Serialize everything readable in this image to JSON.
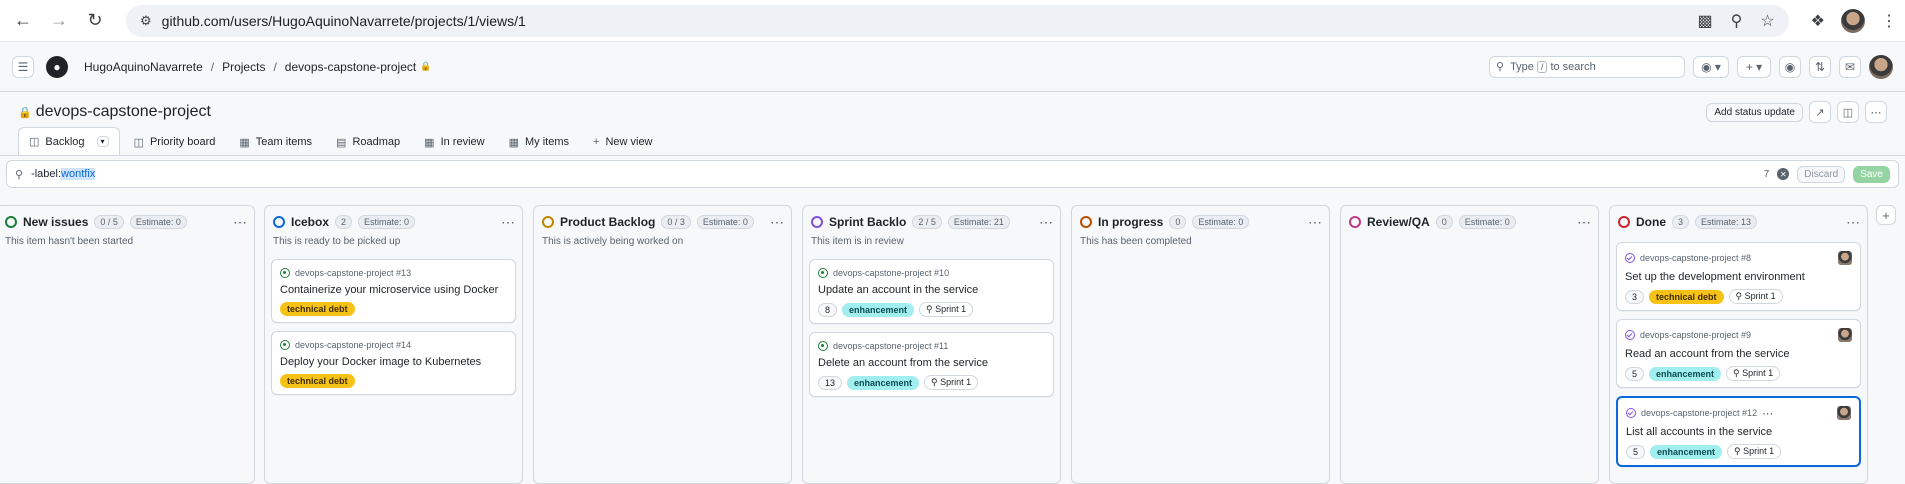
{
  "browser": {
    "url": "github.com/users/HugoAquinoNavarrete/projects/1/views/1"
  },
  "header": {
    "user": "HugoAquinoNavarrete",
    "projects": "Projects",
    "project": "devops-capstone-project",
    "search_prefix": "Type",
    "search_key": "/",
    "search_suffix": "to search"
  },
  "project": {
    "title": "devops-capstone-project",
    "status_update": "Add status update"
  },
  "tabs": [
    {
      "label": "Backlog"
    },
    {
      "label": "Priority board"
    },
    {
      "label": "Team items"
    },
    {
      "label": "Roadmap"
    },
    {
      "label": "In review"
    },
    {
      "label": "My items"
    },
    {
      "label": "New view"
    }
  ],
  "filter": {
    "prefix": "-label:",
    "value": "wontfix",
    "count": "7",
    "discard": "Discard",
    "save": "Save"
  },
  "columns": [
    {
      "name": "New issues",
      "count": "0 / 5",
      "estimate": "Estimate: 0",
      "desc": "This item hasn't been started",
      "color": "#1a7f37",
      "cards": []
    },
    {
      "name": "Icebox",
      "count": "2",
      "estimate": "Estimate: 0",
      "desc": "This is ready to be picked up",
      "color": "#0969da",
      "cards": [
        {
          "ref": "devops-capstone-project #13",
          "title": "Containerize your microservice using Docker",
          "estimate": "",
          "label": "technical debt",
          "label_type": "td",
          "sprint": "",
          "state": "open",
          "avatar": false
        },
        {
          "ref": "devops-capstone-project #14",
          "title": "Deploy your Docker image to Kubernetes",
          "estimate": "",
          "label": "technical debt",
          "label_type": "td",
          "sprint": "",
          "state": "open",
          "avatar": false
        }
      ]
    },
    {
      "name": "Product Backlog",
      "count": "0 / 3",
      "estimate": "Estimate: 0",
      "desc": "This is actively being worked on",
      "color": "#bf8700",
      "cards": []
    },
    {
      "name": "Sprint Backlo",
      "count": "2 / 5",
      "estimate": "Estimate: 21",
      "desc": "This item is in review",
      "color": "#8250df",
      "cards": [
        {
          "ref": "devops-capstone-project #10",
          "title": "Update an account in the service",
          "estimate": "8",
          "label": "enhancement",
          "label_type": "enh",
          "sprint": "Sprint 1",
          "state": "open",
          "avatar": false
        },
        {
          "ref": "devops-capstone-project #11",
          "title": "Delete an account from the service",
          "estimate": "13",
          "label": "enhancement",
          "label_type": "enh",
          "sprint": "Sprint 1",
          "state": "open",
          "avatar": false
        }
      ]
    },
    {
      "name": "In progress",
      "count": "0",
      "estimate": "Estimate: 0",
      "desc": "This has been completed",
      "color": "#bc4c00",
      "cards": []
    },
    {
      "name": "Review/QA",
      "count": "0",
      "estimate": "Estimate: 0",
      "desc": "",
      "color": "#bf3989",
      "cards": []
    },
    {
      "name": "Done",
      "count": "3",
      "estimate": "Estimate: 13",
      "desc": "",
      "color": "#cf222e",
      "cards": [
        {
          "ref": "devops-capstone-project #8",
          "title": "Set up the development environment",
          "estimate": "3",
          "label": "technical debt",
          "label_type": "td",
          "sprint": "Sprint 1",
          "state": "closed",
          "avatar": true
        },
        {
          "ref": "devops-capstone-project #9",
          "title": "Read an account from the service",
          "estimate": "5",
          "label": "enhancement",
          "label_type": "enh",
          "sprint": "Sprint 1",
          "state": "closed",
          "avatar": true
        },
        {
          "ref": "devops-capstone-project #12",
          "title": "List all accounts in the service",
          "estimate": "5",
          "label": "enhancement",
          "label_type": "enh",
          "sprint": "Sprint 1",
          "state": "closed",
          "avatar": true,
          "selected": true
        }
      ]
    }
  ]
}
